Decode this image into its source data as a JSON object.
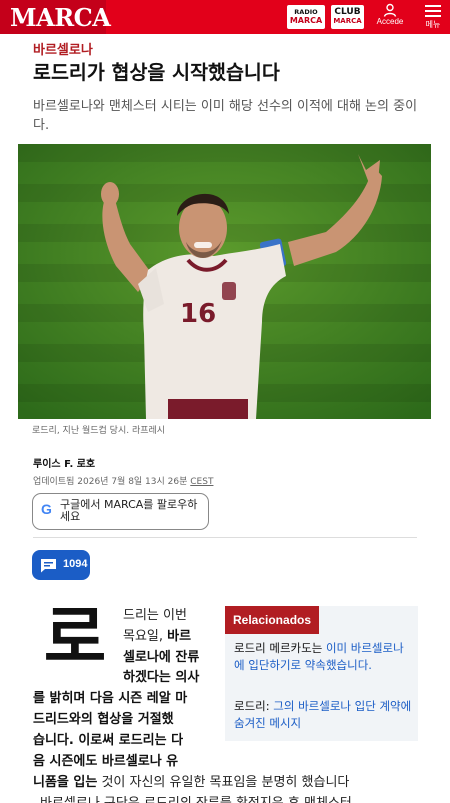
{
  "header": {
    "logo": "MARCA",
    "radio": {
      "line1": "RADIO",
      "line2": "MARCA"
    },
    "club": {
      "line1": "CLUB",
      "line2": "MARCA"
    },
    "accede_label": "Accede",
    "menu_label": "메뉴",
    "colors": {
      "brand_red": "#e2001a",
      "link_blue": "#1b5dc6"
    }
  },
  "article": {
    "kicker": "바르셀로나",
    "title": "로드리가 협상을 시작했습니다",
    "subtitle": "바르셀로나와 맨체스터 시티는 이미 해당 선수의 이적에 대해 논의 중이다.",
    "photo": {
      "jersey_number": "16"
    },
    "caption": "로드리, 지난 월드컵 당시. 라프레시",
    "author": "루이스 F. 로호",
    "updated_label": "업데이트됨",
    "updated_date": "2026년 7월 8일 13시 26분",
    "updated_tz": "CEST",
    "follow_label": "구글에서 MARCA를 팔로우하세요",
    "comments_count": "1094",
    "dropcap": "로",
    "body_lines": {
      "l1": "드리는 이번",
      "l2a": "목요일, ",
      "l2b": "바르",
      "l3": "셀로나에 잔류",
      "l4": "하겠다는 의사",
      "l5": "를 밝히며 다음 시즌 레알 마",
      "l6": "드리드와의 협상을 거절했",
      "l7": "습니다. 이로써 로드리는 다",
      "l8": "음 시즌에도 바르셀로나 유",
      "l9a": "니폼을 입는",
      "l9b": " 것이 자신의 유일한 목표임을 분명히 했습니다",
      "l10": "바르셀로나 구단은 로드리의 잔류를 확정지은 후 맨체스터"
    }
  },
  "related": {
    "heading": "Relacionados",
    "items": [
      {
        "prefix": "로드리 메르카도는 ",
        "link": "이미 바르셀로나에 입단하기로 약속했습니다."
      },
      {
        "prefix": "로드리: ",
        "link": "그의 바르셀로나 입단 계약에 숨겨진 메시지"
      }
    ]
  }
}
